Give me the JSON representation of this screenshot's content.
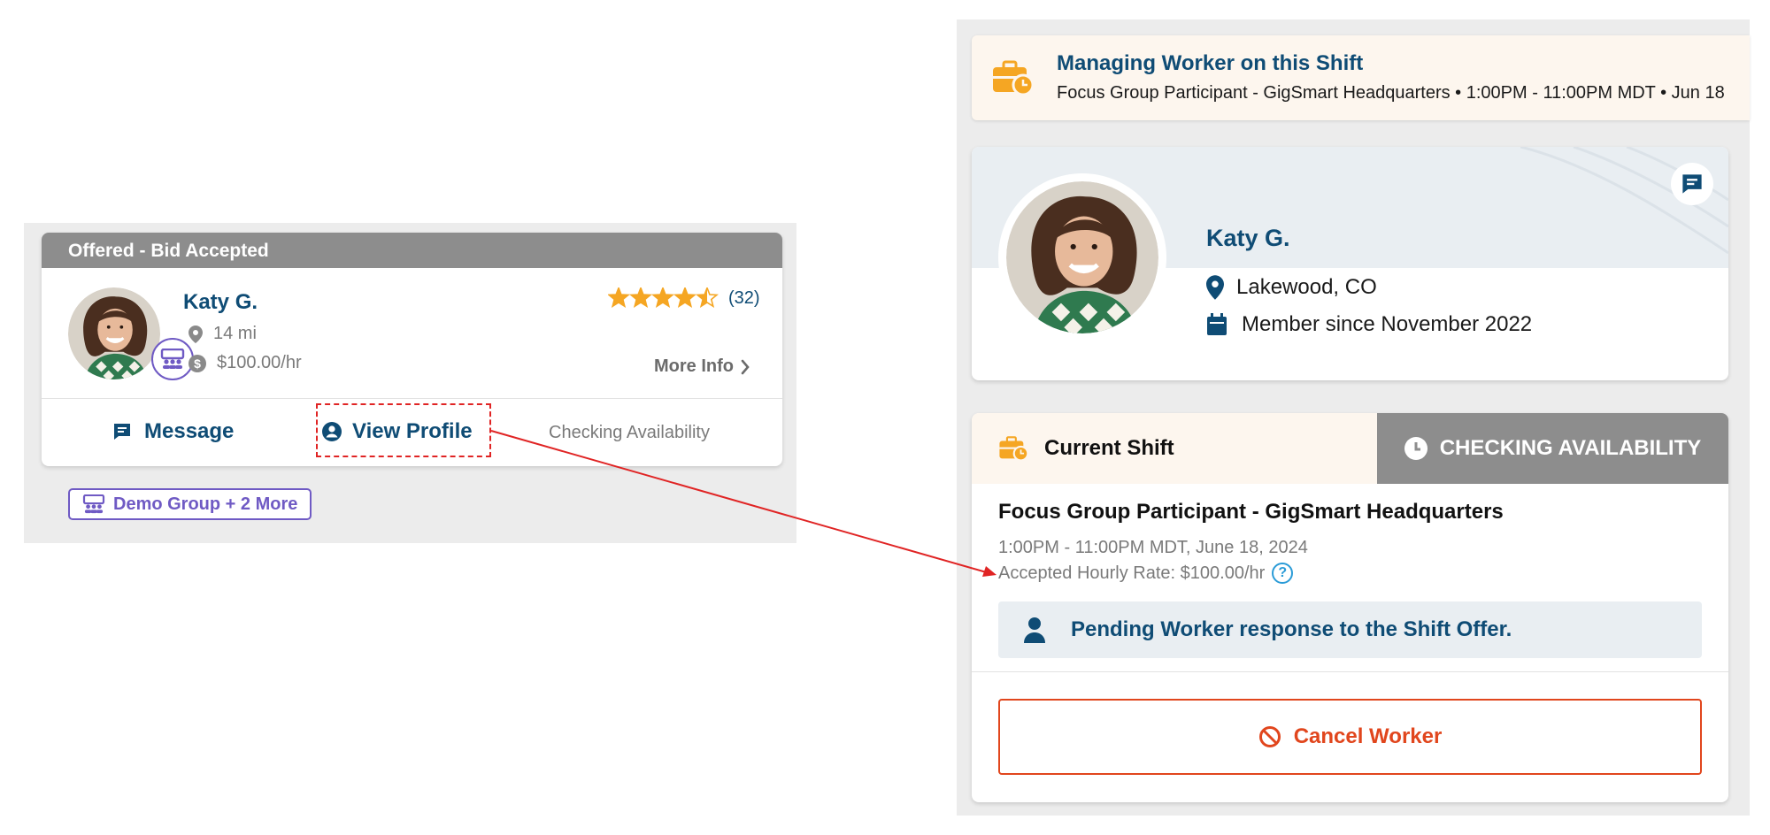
{
  "left_card": {
    "header": "Offered - Bid Accepted",
    "worker_name": "Katy G.",
    "distance": "14 mi",
    "rate": "$100.00/hr",
    "rating_count": "(32)",
    "rating_value": 4.5,
    "more_info": "More Info",
    "actions": {
      "message": "Message",
      "view_profile": "View Profile",
      "checking": "Checking Availability"
    },
    "group_tag": "Demo Group + 2 More"
  },
  "banner": {
    "title": "Managing Worker on this Shift",
    "subtitle": "Focus Group Participant - GigSmart Headquarters • 1:00PM - 11:00PM MDT • Jun 18"
  },
  "profile": {
    "name": "Katy G.",
    "location": "Lakewood, CO",
    "member_since": "Member since November 2022"
  },
  "shift": {
    "tab_label": "Current Shift",
    "status": "CHECKING AVAILABILITY",
    "title": "Focus Group Participant - GigSmart Headquarters",
    "time": "1:00PM - 11:00PM MDT, June 18, 2024",
    "rate": "Accepted Hourly Rate: $100.00/hr",
    "help": "?",
    "pending": "Pending Worker response to the Shift Offer.",
    "cancel": "Cancel Worker"
  },
  "colors": {
    "brand_blue": "#0f4c75",
    "accent_orange": "#f5a623",
    "cancel_red": "#e1461d",
    "group_purple": "#6f5ac4",
    "annotation_red": "#e02424"
  }
}
